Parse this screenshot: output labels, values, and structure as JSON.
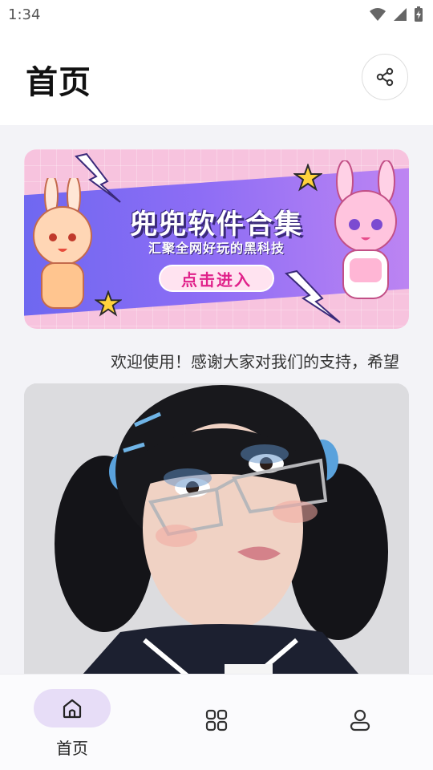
{
  "status_bar": {
    "time": "1:34",
    "icons": [
      "wifi-icon",
      "signal-icon",
      "battery-charging-icon"
    ]
  },
  "header": {
    "title": "首页",
    "share_icon": "share-icon"
  },
  "banner": {
    "title": "兜兜软件合集",
    "subtitle": "汇聚全网好玩的黑科技",
    "cta_label": "点击进入"
  },
  "announcement": {
    "text": "欢迎使用！感谢大家对我们的支持，希望"
  },
  "bottom_nav": {
    "items": [
      {
        "label": "首页",
        "icon": "home-icon",
        "selected": true
      },
      {
        "label": "",
        "icon": "grid-icon",
        "selected": false
      },
      {
        "label": "",
        "icon": "user-icon",
        "selected": false
      }
    ]
  },
  "colors": {
    "accent_pill": "#e7ddf7",
    "content_bg": "#f3f3f7",
    "banner_pink": "#f7c3de",
    "banner_purple": "#8d6df5",
    "cta_text": "#e0218a"
  }
}
